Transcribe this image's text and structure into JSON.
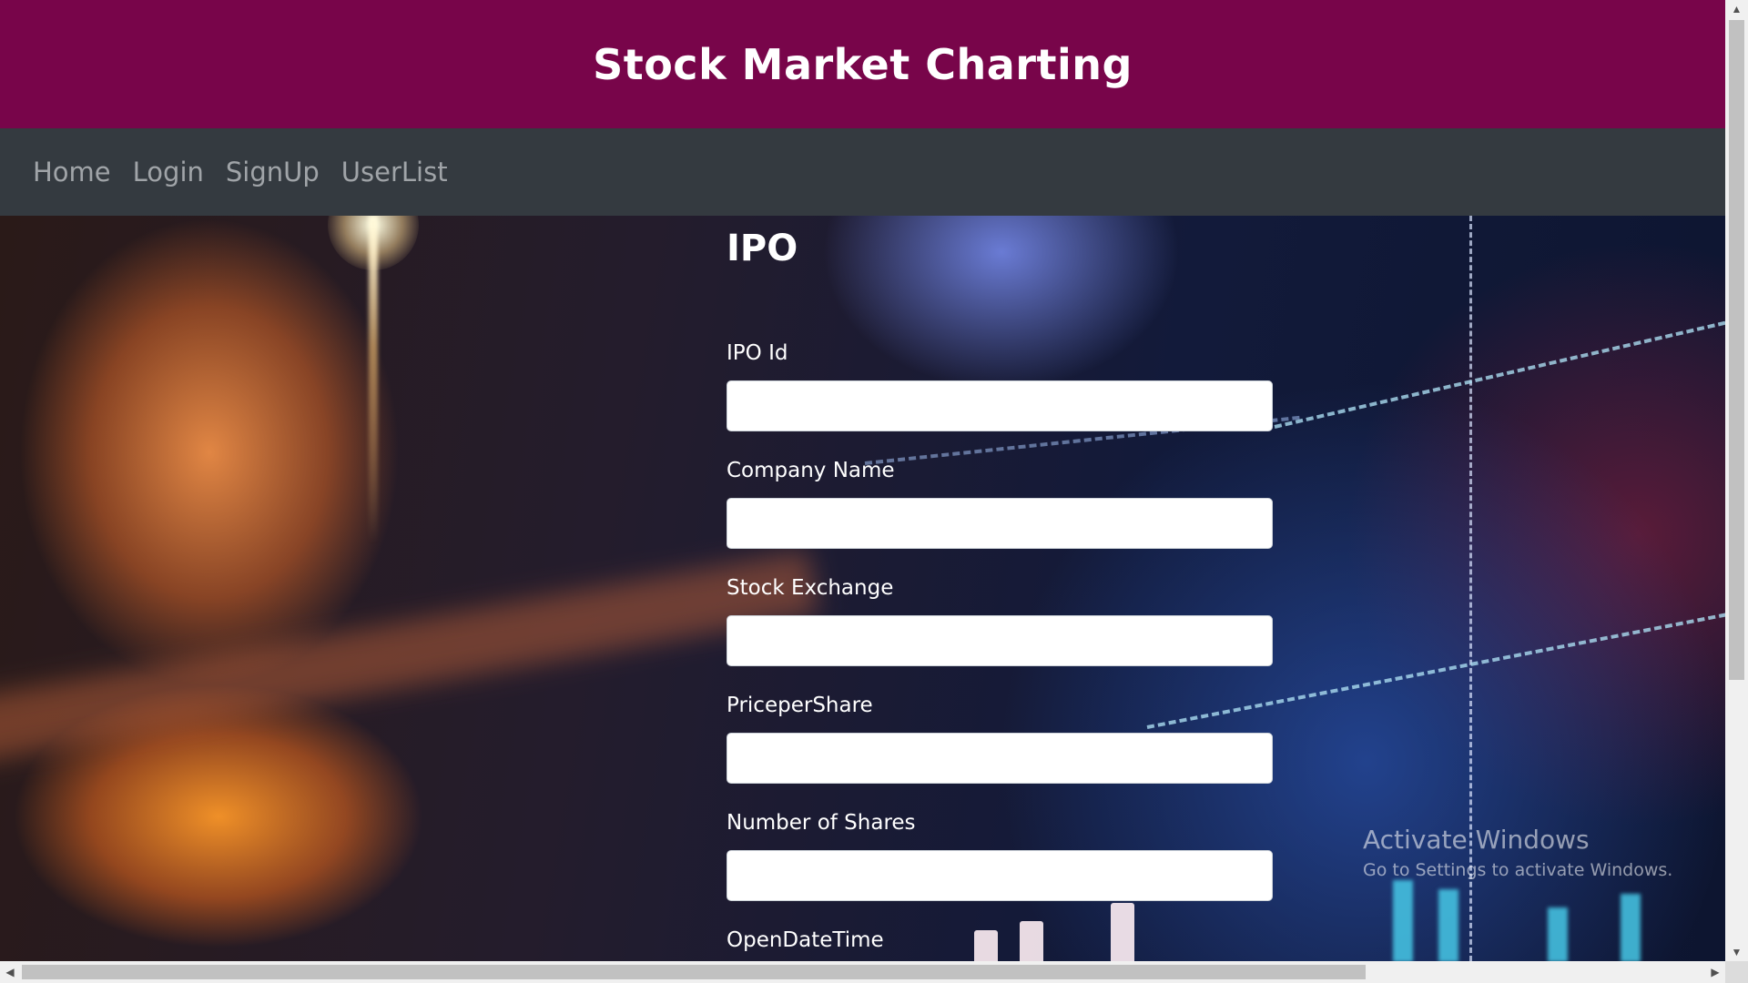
{
  "header": {
    "title": "Stock Market Charting"
  },
  "navbar": {
    "items": [
      {
        "label": "Home"
      },
      {
        "label": "Login"
      },
      {
        "label": "SignUp"
      },
      {
        "label": "UserList"
      }
    ]
  },
  "form": {
    "title": "IPO",
    "fields": [
      {
        "label": "IPO Id",
        "value": ""
      },
      {
        "label": "Company Name",
        "value": ""
      },
      {
        "label": "Stock Exchange",
        "value": ""
      },
      {
        "label": "PriceperShare",
        "value": ""
      },
      {
        "label": "Number of Shares",
        "value": ""
      },
      {
        "label": "OpenDateTime",
        "value": ""
      }
    ]
  },
  "watermark": {
    "title": "Activate Windows",
    "subtitle": "Go to Settings to activate Windows."
  },
  "scrollbars": {
    "up_arrow": "▲",
    "down_arrow": "▼",
    "left_arrow": "◀",
    "right_arrow": "▶"
  },
  "colors": {
    "header_bg": "#78054a",
    "navbar_bg": "#343a40",
    "nav_link": "#a0a4a8"
  }
}
